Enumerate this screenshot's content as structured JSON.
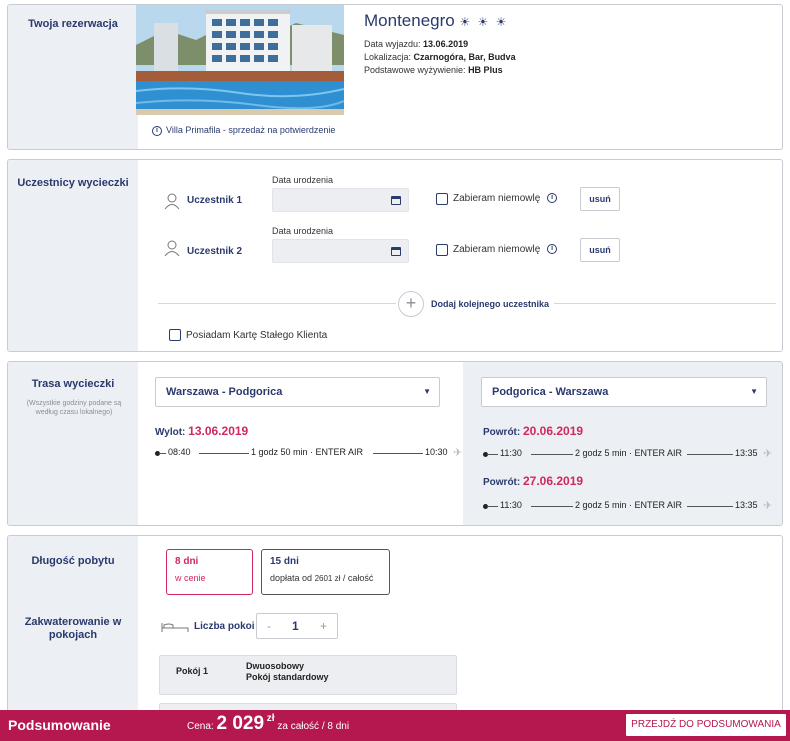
{
  "reservation": {
    "side_title": "Twoja rezerwacja",
    "hotel_name": "Montenegro",
    "stars": "☀ ☀ ☀",
    "departure_label": "Data wyjazdu:",
    "departure_value": "13.06.2019",
    "location_label": "Lokalizacja:",
    "location_value": "Czarnogóra, Bar, Budva",
    "board_label": "Podstawowe wyżywienie:",
    "board_value": "HB Plus",
    "info_link": "Villa Primafila - sprzedaż na potwierdzenie"
  },
  "participants": {
    "side_title": "Uczestnicy wycieczki",
    "dob_label": "Data urodzenia",
    "infant_label": "Zabieram niemowlę",
    "remove_label": "usuń",
    "items": [
      {
        "label": "Uczestnik 1"
      },
      {
        "label": "Uczestnik 2"
      }
    ],
    "add_label": "Dodaj kolejnego uczestnika",
    "loyalty_label": "Posiadam Kartę Stałego Klienta"
  },
  "route": {
    "side_title": "Trasa wycieczki",
    "side_note": "(Wszystkie godziny podane są według czasu lokalnego)",
    "outbound": {
      "select": "Warszawa - Podgorica",
      "label": "Wylot:",
      "date": "13.06.2019",
      "depart": "08:40",
      "info": "1 godz 50 min · ENTER AIR",
      "arrive": "10:30"
    },
    "return": {
      "select": "Podgorica - Warszawa",
      "options": [
        {
          "label": "Powrót:",
          "date": "20.06.2019",
          "depart": "11:30",
          "info": "2 godz 5 min · ENTER AIR",
          "arrive": "13:35"
        },
        {
          "label": "Powrót:",
          "date": "27.06.2019",
          "depart": "11:30",
          "info": "2 godz 5 min · ENTER AIR",
          "arrive": "13:35"
        }
      ]
    }
  },
  "stay": {
    "duration_title": "Długość pobytu",
    "options": [
      {
        "title": "8 dni",
        "sub": "w cenie"
      },
      {
        "title": "15 dni",
        "sub_prefix": "dopłata od",
        "sub_amount": "2601 zł",
        "sub_suffix": "/ całość"
      }
    ],
    "accommodation_title": "Zakwaterowanie w pokojach",
    "rooms_label": "Liczba pokoi",
    "rooms_count": "1",
    "minus": "-",
    "plus": "+",
    "room": {
      "name": "Pokój 1",
      "type": "Dwuosobowy",
      "standard": "Pokój standardowy"
    }
  },
  "footer": {
    "title": "Podsumowanie",
    "price_label": "Cena:",
    "price_value": "2 029",
    "currency": "zł",
    "price_suffix": "za całość / 8 dni",
    "cta": "PRZEJDŹ DO PODSUMOWANIA"
  },
  "colors": {
    "accent": "#d0285c",
    "navy": "#2a3a6e",
    "footer": "#b5184f"
  }
}
